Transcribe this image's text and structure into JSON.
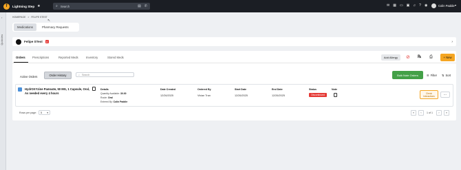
{
  "app": {
    "name": "Lightning Step",
    "logo_letter": "f"
  },
  "search": {
    "placeholder": "Search"
  },
  "user": {
    "name": "Colin Paddie"
  },
  "top_icons": [
    "inbox-icon",
    "calendar-icon",
    "chat-icon",
    "alert-icon",
    "bell-icon",
    "help-icon",
    "video-icon"
  ],
  "leftrail": {
    "label": "Quickview"
  },
  "breadcrumb": {
    "home": "HOMEPAGE",
    "sep": ">",
    "current": "FELIPE STEST"
  },
  "top_tabs": [
    {
      "label": "Medications",
      "active": true
    },
    {
      "label": "Pharmacy Requests",
      "active": false
    }
  ],
  "patient": {
    "name": "Felipe STest",
    "badge": "A"
  },
  "tabs": [
    "Orders",
    "Prescriptions",
    "Reported Meds",
    "Inventory",
    "Stored Meds"
  ],
  "actions": {
    "add_allergy": "Add Allergy",
    "new": "New",
    "new_icon": "+"
  },
  "subtabs": {
    "active_orders": "Active Orders",
    "order_history": "Order History"
  },
  "order_search": {
    "placeholder": "Search"
  },
  "bulk_note": "Bulk Note Orders",
  "filter": "Filter",
  "sort": "Sort",
  "columns": {
    "details": "Details",
    "date_created": "Date Created",
    "ordered_by": "Ordered By",
    "start_date": "Start Date",
    "end_date": "End Date",
    "status": "Status",
    "note": "Note"
  },
  "order": {
    "medication": "HydrOXYzine Pamoate, 50 MG, 1 Capsule, Oral, As needed every 4 hours",
    "quantity_label": "Quantity Available:",
    "quantity": "30.00",
    "route_label": "Route:",
    "route": "Oral",
    "entered_label": "Entered By:",
    "entered_by": "Colin Paddie",
    "date_created": "12/26/2025",
    "ordered_by": "Vivian Tran",
    "start_date": "12/26/2025",
    "end_date": "12/26/2025",
    "status": "Discontinued",
    "check_button": "Check Interactions",
    "more": "..."
  },
  "pagination": {
    "rows_label": "Rows per page:",
    "rows_value": "5",
    "info": "1 of 1"
  },
  "colors": {
    "topbar": "#1b1e24",
    "accent": "#f5a623",
    "success": "#43a047",
    "danger": "#e53935"
  }
}
